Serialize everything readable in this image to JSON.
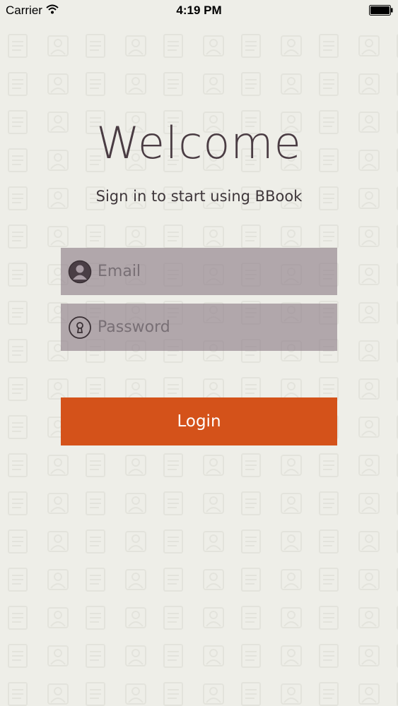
{
  "status_bar": {
    "carrier": "Carrier",
    "time": "4:19 PM",
    "wifi_icon": "wifi-icon",
    "battery_icon": "battery-icon"
  },
  "welcome": {
    "title": "Welcome",
    "subtitle": "Sign in to start using BBook"
  },
  "form": {
    "email": {
      "placeholder": "Email",
      "value": "",
      "icon": "user-icon"
    },
    "password": {
      "placeholder": "Password",
      "value": "",
      "icon": "keyhole-icon"
    },
    "login_label": "Login"
  },
  "colors": {
    "background": "#eeeee8",
    "accent": "#d4521a",
    "field_background": "#94848e",
    "title_text": "#4a3c43"
  }
}
